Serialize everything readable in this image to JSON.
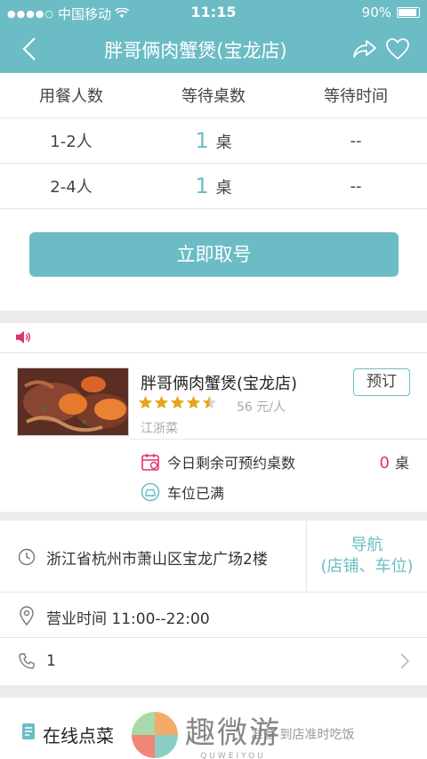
{
  "status_bar": {
    "carrier": "中国移动",
    "time": "11:15",
    "battery": "90%"
  },
  "nav": {
    "title": "胖哥俩肉蟹煲(宝龙店)"
  },
  "queue": {
    "headers": [
      "用餐人数",
      "等待桌数",
      "等待时间"
    ],
    "rows": [
      {
        "party": "1-2人",
        "count": "1",
        "unit": "桌",
        "wait": "--"
      },
      {
        "party": "2-4人",
        "count": "1",
        "unit": "桌",
        "wait": "--"
      }
    ],
    "take_number_label": "立即取号"
  },
  "shop": {
    "name": "胖哥俩肉蟹煲(宝龙店)",
    "rating": 4.5,
    "rating_max": 5,
    "price": "56 元/人",
    "cuisine": "江浙菜",
    "reserve_label": "预订",
    "remaining_label": "今日剩余可预约桌数",
    "remaining_count": "0",
    "remaining_unit": "桌",
    "parking_label": "车位已满"
  },
  "address": {
    "text": "浙江省杭州市萧山区宝龙广场2楼",
    "nav_label": "导航",
    "nav_sub": "(店铺、车位)"
  },
  "hours": {
    "text": "营业时间 11:00--22:00"
  },
  "phone": {
    "text": "1"
  },
  "online_order": {
    "title": "在线点菜",
    "subtitle": "准备 到店准时吃饭"
  },
  "watermark": {
    "title": "趣微游",
    "sub": "QUWEIYOU"
  },
  "colors": {
    "accent": "#6cbcc6",
    "alert": "#e0336a"
  }
}
